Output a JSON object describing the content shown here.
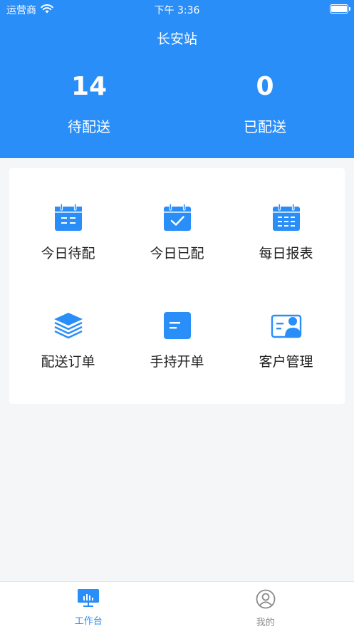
{
  "status_bar": {
    "carrier": "运营商",
    "time": "下午 3:36"
  },
  "header": {
    "title": "长安站",
    "stats": [
      {
        "value": "14",
        "label": "待配送"
      },
      {
        "value": "0",
        "label": "已配送"
      }
    ]
  },
  "menu": {
    "items": [
      {
        "label": "今日待配",
        "icon": "calendar-list-icon"
      },
      {
        "label": "今日已配",
        "icon": "calendar-check-icon"
      },
      {
        "label": "每日报表",
        "icon": "calendar-grid-icon"
      },
      {
        "label": "配送订单",
        "icon": "layers-icon"
      },
      {
        "label": "手持开单",
        "icon": "document-icon"
      },
      {
        "label": "客户管理",
        "icon": "contact-card-icon"
      }
    ]
  },
  "tabbar": {
    "tabs": [
      {
        "label": "工作台",
        "icon": "monitor-chart-icon",
        "active": true
      },
      {
        "label": "我的",
        "icon": "user-circle-icon",
        "active": false
      }
    ]
  },
  "colors": {
    "primary": "#2a8ef8",
    "background": "#f4f6f7",
    "inactive": "#8a8a8a"
  }
}
